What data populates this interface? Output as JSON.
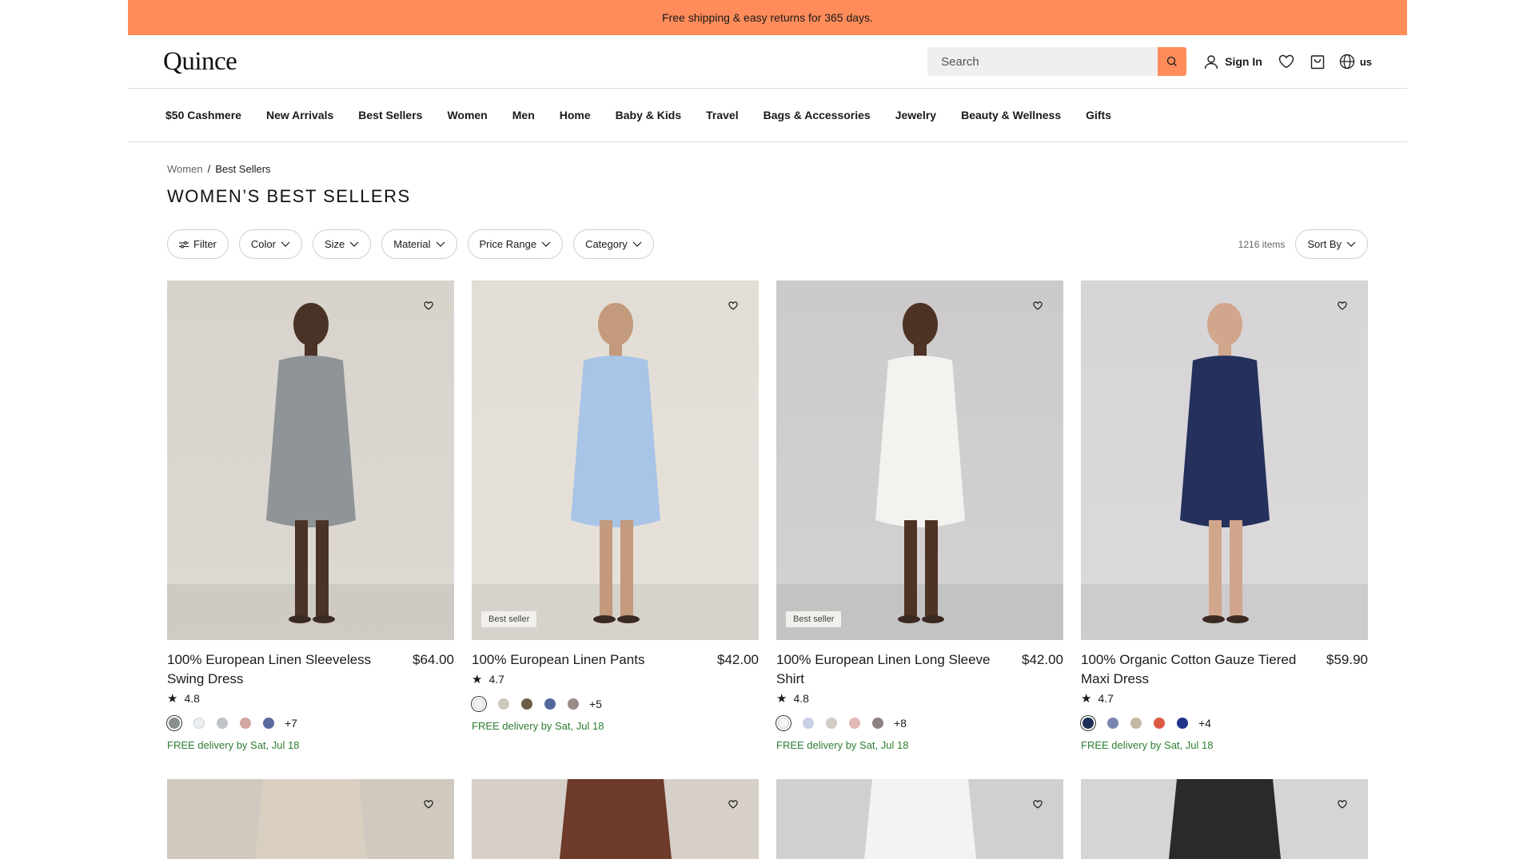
{
  "promo": {
    "text": "Free shipping & easy returns for 365 days."
  },
  "header": {
    "logo": "Quince",
    "search_placeholder": "Search",
    "sign_in": "Sign In",
    "locale": "us"
  },
  "nav": {
    "items": [
      "$50 Cashmere",
      "New Arrivals",
      "Best Sellers",
      "Women",
      "Men",
      "Home",
      "Baby & Kids",
      "Travel",
      "Bags & Accessories",
      "Jewelry",
      "Beauty & Wellness",
      "Gifts"
    ]
  },
  "breadcrumb": {
    "parent": "Women",
    "separator": "/",
    "current": "Best Sellers"
  },
  "page_title": "WOMEN’S BEST SELLERS",
  "filters": {
    "filter_label": "Filter",
    "dropdowns": [
      "Color",
      "Size",
      "Material",
      "Price Range",
      "Category"
    ],
    "item_count": "1216 items",
    "sort_label": "Sort By"
  },
  "products": [
    {
      "name": "100% European Linen Sleeveless Swing Dress",
      "price": "$64.00",
      "rating": "4.8",
      "badge": "",
      "swatches": [
        "#8a9090",
        "#eceff2",
        "#c0c4c8",
        "#d4a6a0",
        "#5a6a9c"
      ],
      "more": "+7",
      "delivery": "FREE delivery by Sat, Jul 18",
      "bg": "#d8d3cc",
      "garment": "#8e9497",
      "skin": "#4a3326"
    },
    {
      "name": "100% European Linen Pants",
      "price": "$42.00",
      "rating": "4.7",
      "badge": "Best seller",
      "swatches": [
        "#f4f2ee",
        "#cfc8bf",
        "#6b5e45",
        "#52689a",
        "#9a8a85"
      ],
      "more": "+5",
      "delivery": "FREE delivery by Sat, Jul 18",
      "bg": "#e2ddd5",
      "garment": "#a8c4e6",
      "skin": "#c39a7c"
    },
    {
      "name": "100% European Linen Long Sleeve Shirt",
      "price": "$42.00",
      "rating": "4.8",
      "badge": "Best seller",
      "swatches": [
        "#f6f6f4",
        "#c8d0e4",
        "#d2ccc6",
        "#e2b7b5",
        "#8d8280"
      ],
      "more": "+8",
      "delivery": "FREE delivery by Sat, Jul 18",
      "bg": "#cccaca",
      "garment": "#f3f2ef",
      "skin": "#4e3324"
    },
    {
      "name": "100% Organic Cotton Gauze Tiered Maxi Dress",
      "price": "$59.90",
      "rating": "4.7",
      "badge": "",
      "swatches": [
        "#1f2e56",
        "#7a86b0",
        "#c6b6a6",
        "#dd5a45",
        "#22358a"
      ],
      "more": "+4",
      "delivery": "FREE delivery by Sat, Jul 18",
      "bg": "#d6d4d6",
      "garment": "#25315c",
      "skin": "#d1a68c"
    }
  ],
  "row2": [
    {
      "bg": "#cfc9c0",
      "garment": "#d9cfc0"
    },
    {
      "bg": "#d6d0c8",
      "garment": "#6e3a2a"
    },
    {
      "bg": "#d2d0cf",
      "garment": "#f4f3f1"
    },
    {
      "bg": "#d6d4d4",
      "garment": "#2a2a2a"
    }
  ]
}
